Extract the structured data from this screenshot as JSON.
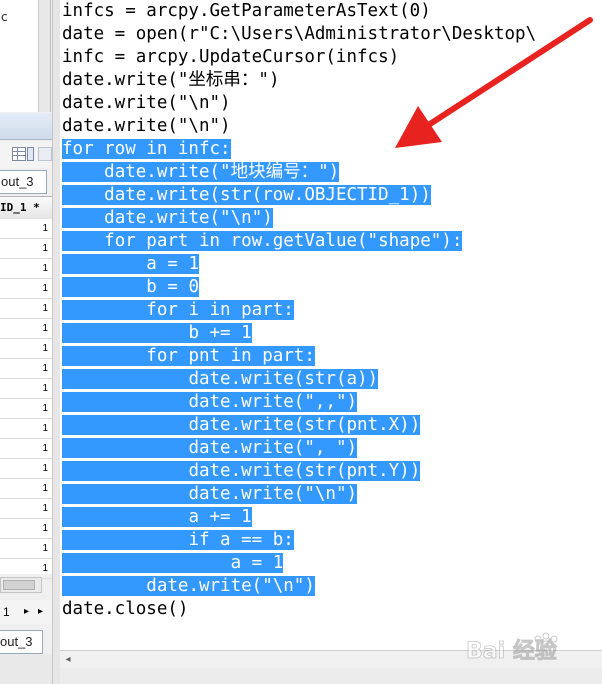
{
  "left_pane": {
    "top_letter": "c",
    "tab1_label": "out_3",
    "column_header": "ID_1 *",
    "row_values": [
      "1",
      "1",
      "1",
      "1",
      "1",
      "1",
      "1",
      "1",
      "1",
      "1",
      "1",
      "1",
      "1",
      "1",
      "1",
      "1",
      "1",
      "1"
    ],
    "page_number": "1",
    "nav_next": "▸",
    "nav_more": "▸",
    "tab2_label": "out_3"
  },
  "editor": {
    "lines": [
      {
        "indent": "",
        "text": "infcs = arcpy.GetParameterAsText(0)",
        "selected": false
      },
      {
        "indent": "",
        "text": "date = open(r\"C:\\Users\\Administrator\\Desktop\\",
        "selected": false
      },
      {
        "indent": "",
        "text": "infc = arcpy.UpdateCursor(infcs)",
        "selected": false
      },
      {
        "indent": "",
        "text": "date.write(\"坐标串：\")",
        "selected": false
      },
      {
        "indent": "",
        "text": "date.write(\"\\n\")",
        "selected": false
      },
      {
        "indent": "",
        "text": "date.write(\"\\n\")",
        "selected": false
      },
      {
        "indent": "",
        "text": "for row in infc:",
        "selected": true
      },
      {
        "indent": "    ",
        "text": "date.write(\"地块编号：\")",
        "selected": true
      },
      {
        "indent": "    ",
        "text": "date.write(str(row.OBJECTID_1))",
        "selected": true
      },
      {
        "indent": "    ",
        "text": "date.write(\"\\n\")",
        "selected": true
      },
      {
        "indent": "    ",
        "text": "for part in row.getValue(\"shape\"):",
        "selected": true
      },
      {
        "indent": "        ",
        "text": "a = 1",
        "selected": true
      },
      {
        "indent": "        ",
        "text": "b = 0",
        "selected": true
      },
      {
        "indent": "        ",
        "text": "for i in part:",
        "selected": true
      },
      {
        "indent": "            ",
        "text": "b += 1",
        "selected": true
      },
      {
        "indent": "        ",
        "text": "for pnt in part:",
        "selected": true
      },
      {
        "indent": "            ",
        "text": "date.write(str(a))",
        "selected": true
      },
      {
        "indent": "            ",
        "text": "date.write(\",,\")",
        "selected": true
      },
      {
        "indent": "            ",
        "text": "date.write(str(pnt.X))",
        "selected": true
      },
      {
        "indent": "            ",
        "text": "date.write(\", \")",
        "selected": true
      },
      {
        "indent": "            ",
        "text": "date.write(str(pnt.Y))",
        "selected": true
      },
      {
        "indent": "            ",
        "text": "date.write(\"\\n\")",
        "selected": true
      },
      {
        "indent": "            ",
        "text": "a += 1",
        "selected": true
      },
      {
        "indent": "            ",
        "text": "if a == b:",
        "selected": true
      },
      {
        "indent": "                ",
        "text": "a = 1",
        "selected": true
      },
      {
        "indent": "        ",
        "text": "date.write(\"\\n\")",
        "selected": true
      },
      {
        "indent": "",
        "text": "date.close()",
        "selected": false
      }
    ]
  },
  "annotation": {
    "arrow_color": "#e8231f"
  },
  "watermark": {
    "text": "Bai 经验"
  },
  "colors": {
    "selection": "#3399ff",
    "selection_text": "#ffffff"
  }
}
